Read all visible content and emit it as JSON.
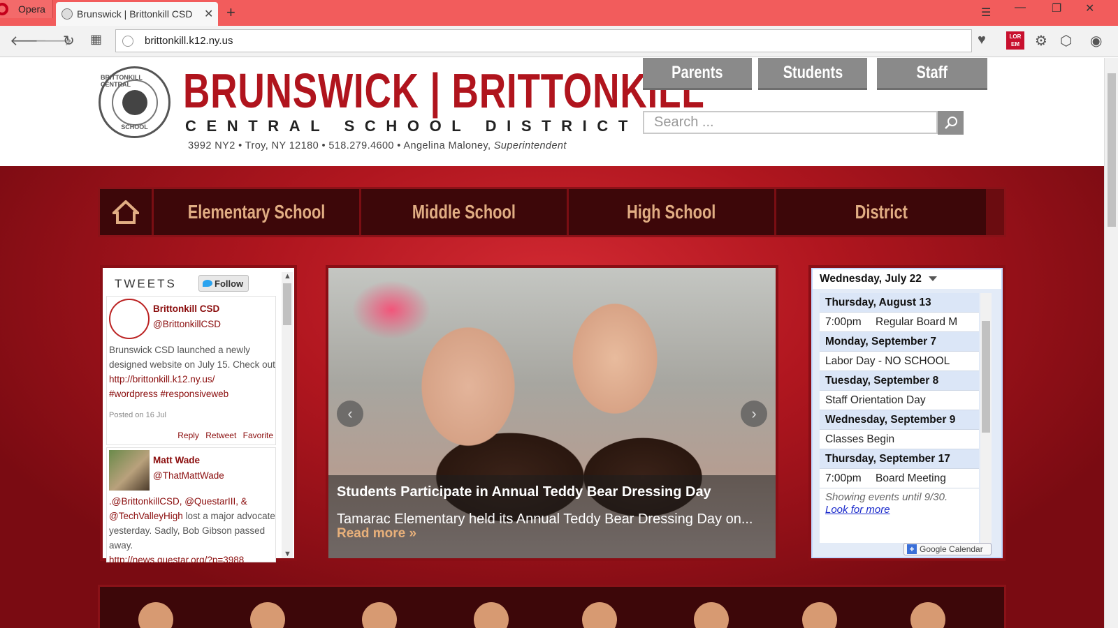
{
  "browser": {
    "menu_label": "Opera",
    "tab_title": "Brunswick | Brittonkill CSD",
    "url": "brittonkill.k12.ny.us",
    "lorem_badge": "LOR EM"
  },
  "header": {
    "seal_top": "BRITTONKILL CENTRAL",
    "seal_bottom": "SCHOOL",
    "brand": "BRUNSWICK | BRITTONKILL",
    "brand_sub": "CENTRAL SCHOOL DISTRICT",
    "address": "3992 NY2 • Troy, NY  12180 • 518.279.4600 • Angelina Maloney, ",
    "superintendent": "Superintendent",
    "audience": [
      "Parents",
      "Students",
      "Staff"
    ],
    "search_placeholder": "Search ..."
  },
  "nav": {
    "items": [
      "Elementary School",
      "Middle School",
      "High School",
      "District"
    ]
  },
  "tweets": {
    "heading": "TWEETS",
    "follow_label": "Follow",
    "items": [
      {
        "name": "Brittonkill CSD",
        "handle": "@BrittonkillCSD",
        "text": "Brunswick CSD launched a newly designed website on July 15. Check out ",
        "link": "http://brittonkill.k12.ny.us/",
        "tags": "#wordpress #responsiveweb",
        "posted": "Posted on 16 Jul",
        "actions": [
          "Reply",
          "Retweet",
          "Favorite"
        ]
      },
      {
        "name": "Matt Wade",
        "handle": "@ThatMattWade",
        "mentions": ".@BrittonkillCSD, @QuestarIII, & @TechValleyHigh",
        "text": " lost a major advocate yesterday. Sadly, Bob Gibson passed away.",
        "link": "http://news.questar.org/?p=3988"
      }
    ]
  },
  "slider": {
    "title": "Students Participate in Annual Teddy Bear Dressing Day",
    "text": "Tamarac Elementary held its Annual Teddy Bear Dressing Day on...",
    "read_more": "Read more »"
  },
  "calendar": {
    "current_date": "Wednesday, July 22",
    "events": [
      {
        "type": "date",
        "label": "Thursday, August 13"
      },
      {
        "type": "event",
        "time": "7:00pm",
        "label": "Regular Board M"
      },
      {
        "type": "date",
        "label": "Monday, September 7"
      },
      {
        "type": "event",
        "time": "",
        "label": "Labor Day - NO SCHOOL"
      },
      {
        "type": "date",
        "label": "Tuesday, September 8"
      },
      {
        "type": "event",
        "time": "",
        "label": "Staff Orientation Day"
      },
      {
        "type": "date",
        "label": "Wednesday, September 9"
      },
      {
        "type": "event",
        "time": "",
        "label": "Classes Begin"
      },
      {
        "type": "date",
        "label": "Thursday, September 17"
      },
      {
        "type": "event",
        "time": "7:00pm",
        "label": "Board Meeting"
      }
    ],
    "footer_text": "Showing events until 9/30.",
    "footer_link": "Look for more",
    "google_label": "Google Calendar"
  },
  "colors": {
    "brand_red": "#b0141d",
    "nav_dark": "#3d0709",
    "nav_text": "#e1ad83",
    "aud_gray": "#8a8a8a"
  }
}
